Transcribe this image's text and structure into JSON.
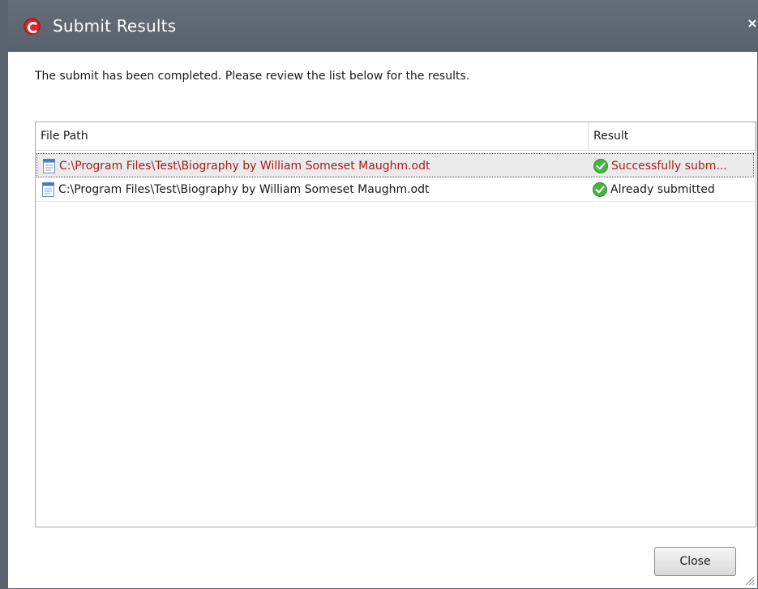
{
  "window": {
    "title": "Submit Results",
    "close_glyph": "×"
  },
  "message": "The submit has been completed. Please review the list below for the results.",
  "list": {
    "columns": {
      "path": "File Path",
      "result": "Result"
    },
    "rows": [
      {
        "path": "C:\\Program Files\\Test\\Biography by William Someset Maughm.odt",
        "result": "Successfully subm...",
        "selected": true
      },
      {
        "path": "C:\\Program Files\\Test\\Biography by William Someset Maughm.odt",
        "result": "Already submitted",
        "selected": false
      }
    ]
  },
  "buttons": {
    "close": "Close"
  },
  "icons": {
    "app_logo": "comodo-logo-icon",
    "file": "document-icon",
    "result_ok": "green-check-icon"
  },
  "colors": {
    "titlebar": "#5e6772",
    "selected_text": "#a61b1b",
    "ok_green": "#3fae3a"
  }
}
